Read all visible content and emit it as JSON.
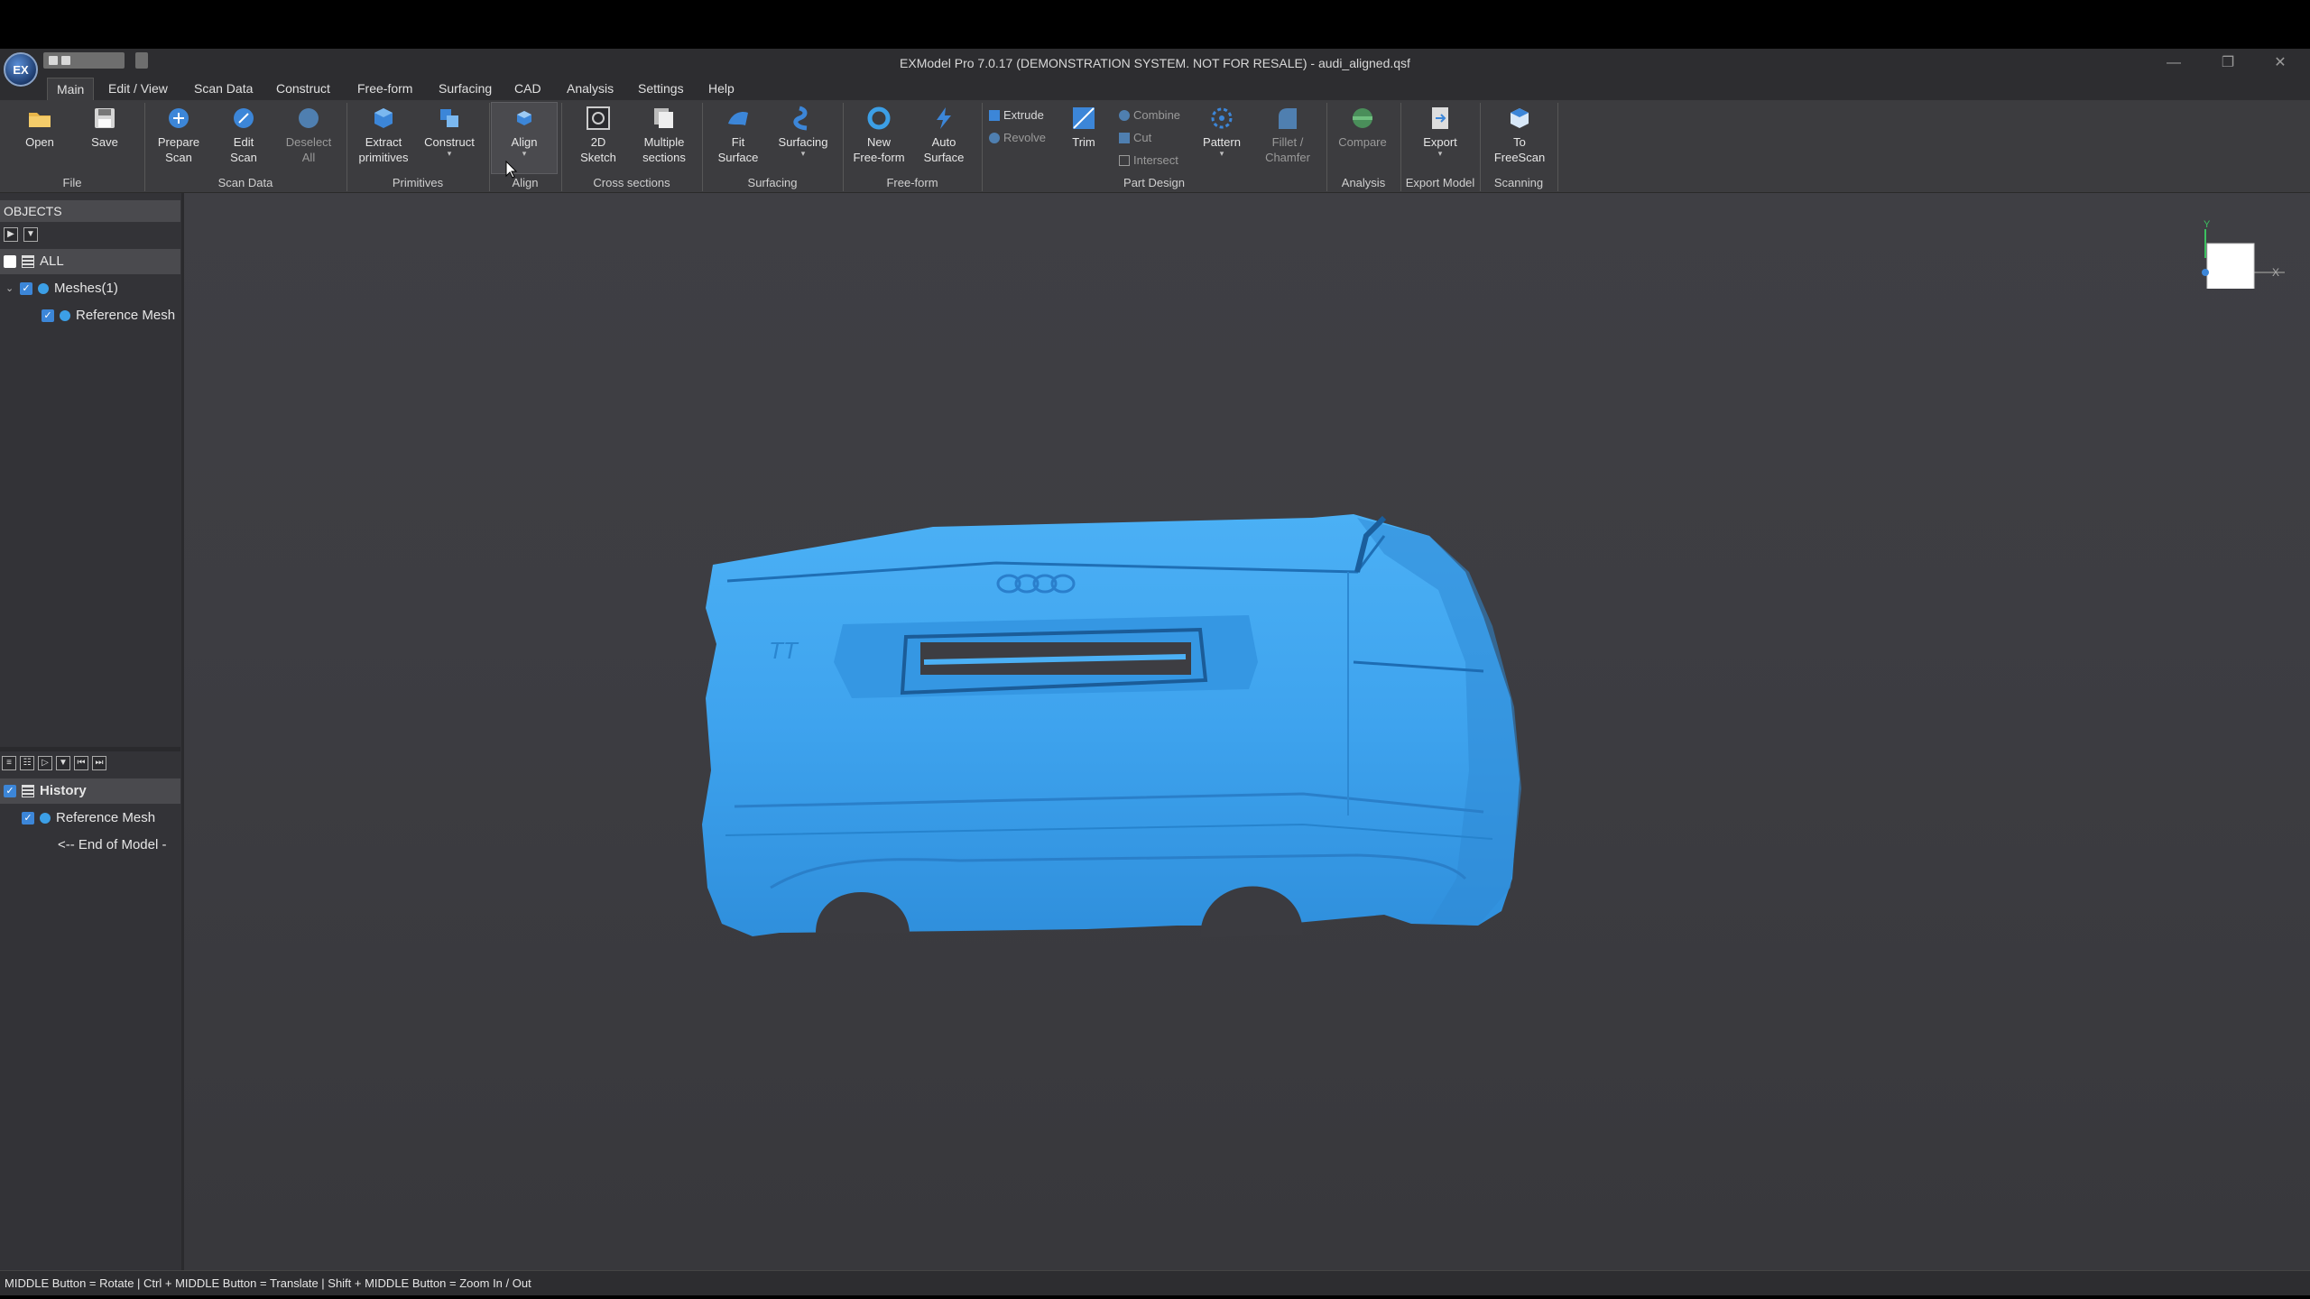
{
  "window": {
    "title": "EXModel Pro 7.0.17 (DEMONSTRATION SYSTEM. NOT FOR RESALE) - audi_aligned.qsf",
    "logo_text": "EX"
  },
  "menu": {
    "tabs": [
      "Main",
      "Edit / View",
      "Scan Data",
      "Construct",
      "Free-form",
      "Surfacing",
      "CAD",
      "Analysis",
      "Settings",
      "Help"
    ],
    "active": "Main"
  },
  "ribbon": {
    "buttons": {
      "open": "Open",
      "save": "Save",
      "prepare_scan": [
        "Prepare",
        "Scan"
      ],
      "edit_scan": [
        "Edit",
        "Scan"
      ],
      "deselect_all": [
        "Deselect",
        "All"
      ],
      "extract_primitives": [
        "Extract",
        "primitives"
      ],
      "construct": "Construct",
      "align": "Align",
      "sketch_2d": [
        "2D",
        "Sketch"
      ],
      "multiple_sections": [
        "Multiple",
        "sections"
      ],
      "fit_surface": [
        "Fit",
        "Surface"
      ],
      "surfacing": "Surfacing",
      "new_freeform": [
        "New",
        "Free-form"
      ],
      "auto_surface": [
        "Auto",
        "Surface"
      ],
      "extrude": "Extrude",
      "revolve": "Revolve",
      "trim": "Trim",
      "combine": "Combine",
      "cut": "Cut",
      "intersect": "Intersect",
      "pattern": "Pattern",
      "fillet_chamfer": [
        "Fillet /",
        "Chamfer"
      ],
      "compare": "Compare",
      "export": "Export",
      "to_freescan": [
        "To",
        "FreeScan"
      ]
    },
    "groups": {
      "file": "File",
      "scan_data": "Scan Data",
      "primitives": "Primitives",
      "align": "Align",
      "cross_sections": "Cross sections",
      "surfacing": "Surfacing",
      "freeform": "Free-form",
      "part_design": "Part Design",
      "analysis": "Analysis",
      "export_model": "Export Model",
      "scanning": "Scanning"
    }
  },
  "objects_panel": {
    "header": "OBJECTS",
    "all": "ALL",
    "meshes": "Meshes(1)",
    "reference_mesh": "Reference Mesh"
  },
  "history_panel": {
    "header": "History",
    "reference_mesh": "Reference Mesh",
    "end_of_model": "<-- End of Model -"
  },
  "viewcube": {
    "y_label": "Y",
    "x_label": "X"
  },
  "status": "MIDDLE Button = Rotate | Ctrl + MIDDLE Button = Translate | Shift + MIDDLE Button = Zoom In / Out",
  "colors": {
    "mesh": "#3ea3ee",
    "accent": "#3c86d8",
    "background": "#3d3d42"
  }
}
